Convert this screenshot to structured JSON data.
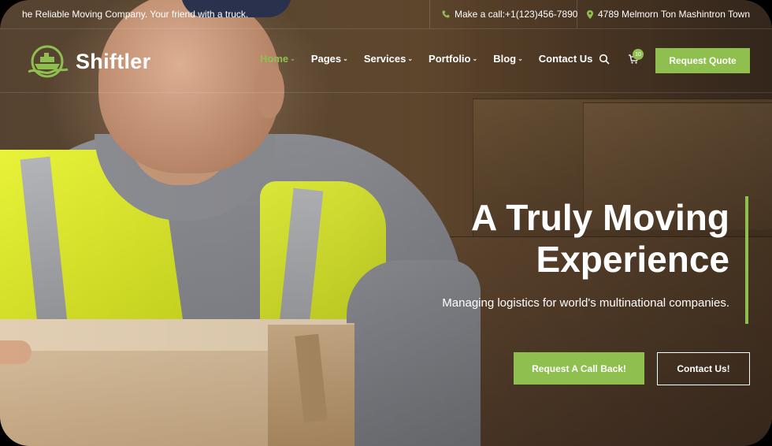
{
  "topbar": {
    "tagline": "he Reliable Moving Company. Your friend with a truck.",
    "phone": "Make a call:+1(123)456-7890",
    "address": "4789 Melmorn Ton Mashintron Town"
  },
  "brand": {
    "name": "Shiftler"
  },
  "nav": {
    "items": [
      {
        "label": "Home",
        "active": true,
        "dropdown": true
      },
      {
        "label": "Pages",
        "dropdown": true
      },
      {
        "label": "Services",
        "dropdown": true
      },
      {
        "label": "Portfolio",
        "dropdown": true
      },
      {
        "label": "Blog",
        "dropdown": true
      },
      {
        "label": "Contact Us",
        "dropdown": false
      }
    ],
    "cart_count": "10",
    "cta": "Request Quote"
  },
  "hero": {
    "title_line1": "A Truly Moving",
    "title_line2": "Experience",
    "subtitle": "Managing logistics for world's multinational companies.",
    "primary_button": "Request A Call Back!",
    "secondary_button": "Contact Us!"
  },
  "colors": {
    "accent": "#8fc04f",
    "text": "#ffffff"
  },
  "icons": [
    "phone-icon",
    "location-pin-icon",
    "ship-logo-icon",
    "search-icon",
    "cart-icon",
    "chevron-down-icon"
  ]
}
